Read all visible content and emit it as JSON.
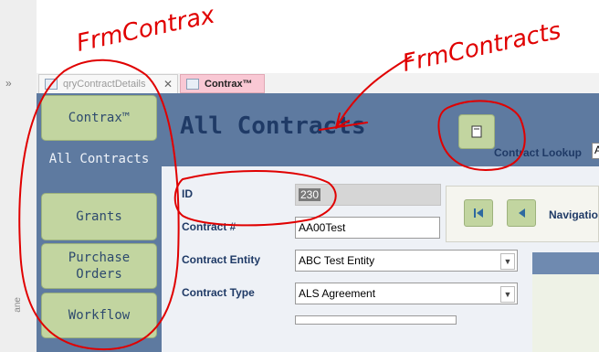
{
  "pane": {
    "collapse_glyph": "»",
    "label": "ane"
  },
  "tabs": [
    {
      "label": "qryContractDetails",
      "icon": "query-icon",
      "close": "✕"
    },
    {
      "label": "Contrax™",
      "icon": "form-icon"
    }
  ],
  "nav": {
    "contrax": "Contrax™",
    "all_contracts": "All Contracts",
    "grants": "Grants",
    "purchase_orders": "Purchase Orders",
    "workflow": "Workflow"
  },
  "header": {
    "title": "All Contracts",
    "lookup_label": "Contract Lookup",
    "lookup_value": "A"
  },
  "fields": {
    "id_label": "ID",
    "id_value": "230",
    "contract_label": "Contract #",
    "contract_value": "AA00Test",
    "entity_label": "Contract Entity",
    "entity_value": "ABC Test Entity",
    "type_label": "Contract Type",
    "type_value": "ALS Agreement"
  },
  "navigation": {
    "label": "Navigatio"
  },
  "annotations": {
    "left": "FrmContrax",
    "right": "FrmContracts"
  },
  "colors": {
    "form_bg": "#5e7aa0",
    "button_green": "#c2d5a0",
    "title_blue": "#1f3a66",
    "tab_active": "#f9c8d4",
    "annotation_red": "#e00000"
  }
}
